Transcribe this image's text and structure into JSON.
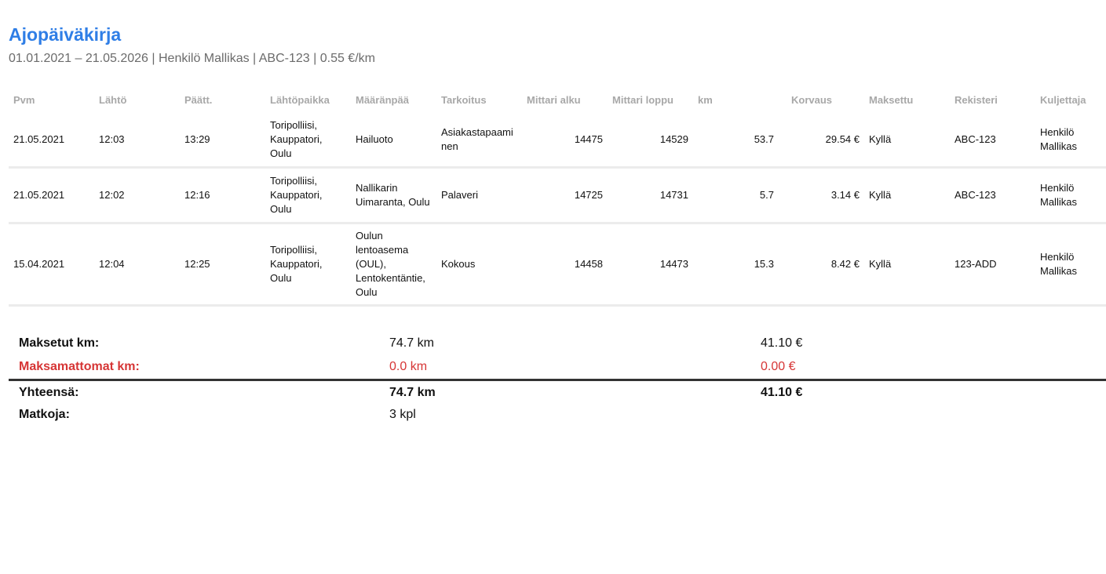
{
  "header": {
    "title": "Ajopäiväkirja",
    "subtitle": "01.01.2021 – 21.05.2026 | Henkilö Mallikas | ABC-123 | 0.55 €/km"
  },
  "table": {
    "columns": [
      "Pvm",
      "Lähtö",
      "Päätt.",
      "Lähtöpaikka",
      "Määränpää",
      "Tarkoitus",
      "Mittari alku",
      "Mittari loppu",
      "km",
      "Korvaus",
      "Maksettu",
      "Rekisteri",
      "Kuljettaja"
    ],
    "rows": [
      [
        "21.05.2021",
        "12:03",
        "13:29",
        "Toripolliisi, Kauppatori, Oulu",
        "Hailuoto",
        "Asiakastapaaminen",
        "14475",
        "14529",
        "53.7",
        "29.54 €",
        "Kyllä",
        "ABC-123",
        "Henkilö Mallikas"
      ],
      [
        "21.05.2021",
        "12:02",
        "12:16",
        "Toripolliisi, Kauppatori, Oulu",
        "Nallikarin Uimaranta, Oulu",
        "Palaveri",
        "14725",
        "14731",
        "5.7",
        "3.14 €",
        "Kyllä",
        "ABC-123",
        "Henkilö Mallikas"
      ],
      [
        "15.04.2021",
        "12:04",
        "12:25",
        "Toripolliisi, Kauppatori, Oulu",
        "Oulun lentoasema (OUL), Lentokentäntie, Oulu",
        "Kokous",
        "14458",
        "14473",
        "15.3",
        "8.42 €",
        "Kyllä",
        "123-ADD",
        "Henkilö Mallikas"
      ]
    ]
  },
  "summary": {
    "paid": {
      "label": "Maksetut km:",
      "km": "74.7 km",
      "eur": "41.10 €"
    },
    "unpaid": {
      "label": "Maksamattomat km:",
      "km": "0.0 km",
      "eur": "0.00 €"
    },
    "total": {
      "label": "Yhteensä:",
      "km": "74.7 km",
      "eur": "41.10 €"
    },
    "trips": {
      "label": "Matkoja:",
      "value": "3 kpl"
    }
  },
  "colors": {
    "title": "#2f7ee6",
    "unpaid": "#d63535",
    "header_text": "#a8a8a8"
  }
}
